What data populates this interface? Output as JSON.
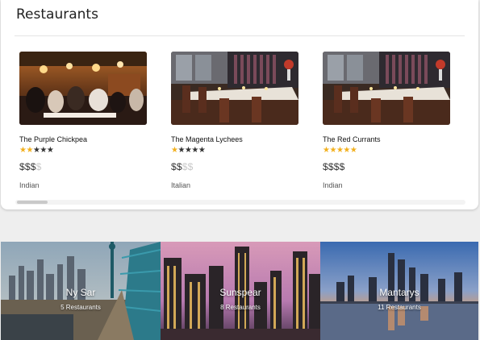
{
  "section": {
    "title": "Restaurants"
  },
  "restaurants": [
    {
      "name": "The Purple Chickpea",
      "rating": 2,
      "max_rating": 5,
      "price_on": "$$$",
      "price_off": "$",
      "cuisine": "Indian",
      "image": "dining-room-photo"
    },
    {
      "name": "The Magenta Lychees",
      "rating": 1,
      "max_rating": 5,
      "price_on": "$$",
      "price_off": "$$",
      "cuisine": "Italian",
      "image": "restaurant-interior-photo"
    },
    {
      "name": "The Red Currants",
      "rating": 5,
      "max_rating": 5,
      "price_on": "$$$$",
      "price_off": "",
      "cuisine": "Indian",
      "image": "restaurant-interior-photo"
    }
  ],
  "cities": [
    {
      "name": "Ny Sar",
      "count": "5 Restaurants",
      "image": "bridge-skyline-photo"
    },
    {
      "name": "Sunspear",
      "count": "8 Restaurants",
      "image": "night-skyline-photo"
    },
    {
      "name": "Mantarys",
      "count": "11 Restaurants",
      "image": "river-skyline-photo"
    }
  ],
  "colors": {
    "star_on": "#f2b01e",
    "star_off": "#333333",
    "price_dim": "#c8c8c8"
  }
}
